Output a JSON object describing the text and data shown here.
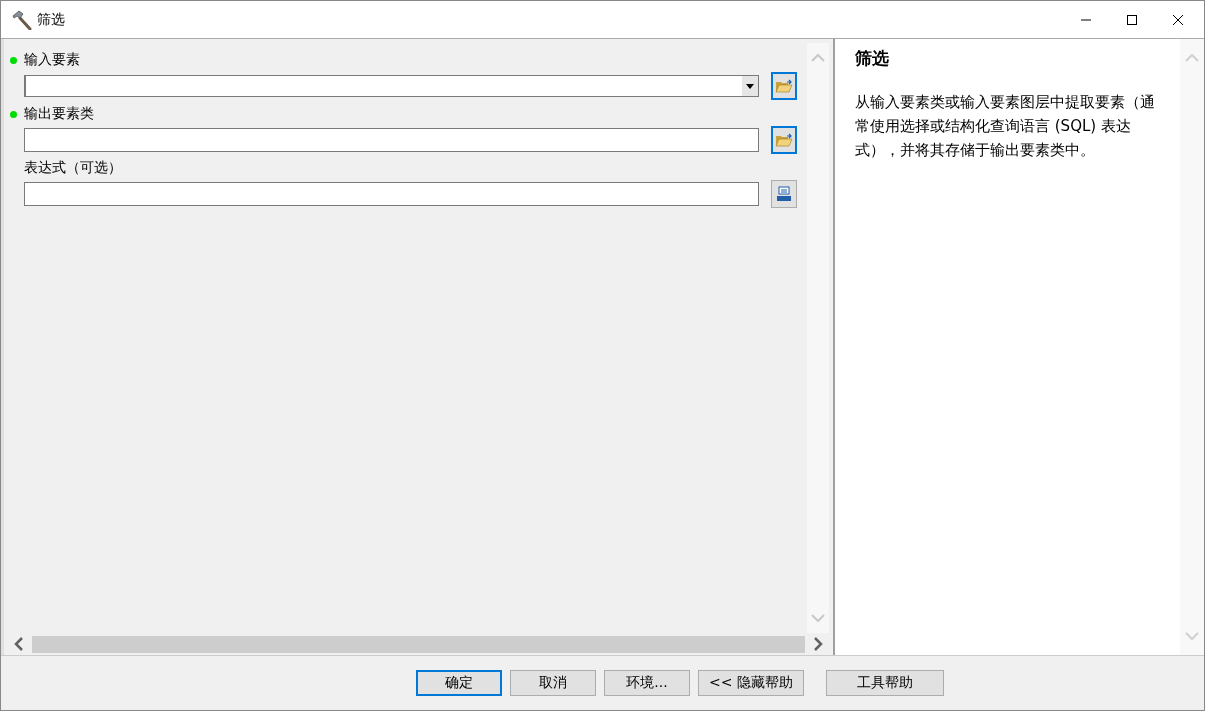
{
  "window": {
    "title": "筛选"
  },
  "parameters": [
    {
      "label": "输入要素",
      "required": true,
      "kind": "dropdown",
      "button": {
        "kind": "folder",
        "highlighted": true
      }
    },
    {
      "label": "输出要素类",
      "required": true,
      "kind": "text",
      "button": {
        "kind": "folder",
        "highlighted": true
      }
    },
    {
      "label": "表达式（可选）",
      "required": false,
      "kind": "text",
      "button": {
        "kind": "sql",
        "highlighted": false
      }
    }
  ],
  "help": {
    "title": "筛选",
    "text": "从输入要素类或输入要素图层中提取要素（通常使用选择或结构化查询语言 (SQL) 表达式），并将其存储于输出要素类中。"
  },
  "buttons": [
    {
      "label": "确定",
      "default": true
    },
    {
      "label": "取消",
      "default": false
    },
    {
      "label": "环境...",
      "default": false
    },
    {
      "label": "<< 隐藏帮助",
      "default": false
    },
    {
      "label": "工具帮助",
      "default": false
    }
  ]
}
